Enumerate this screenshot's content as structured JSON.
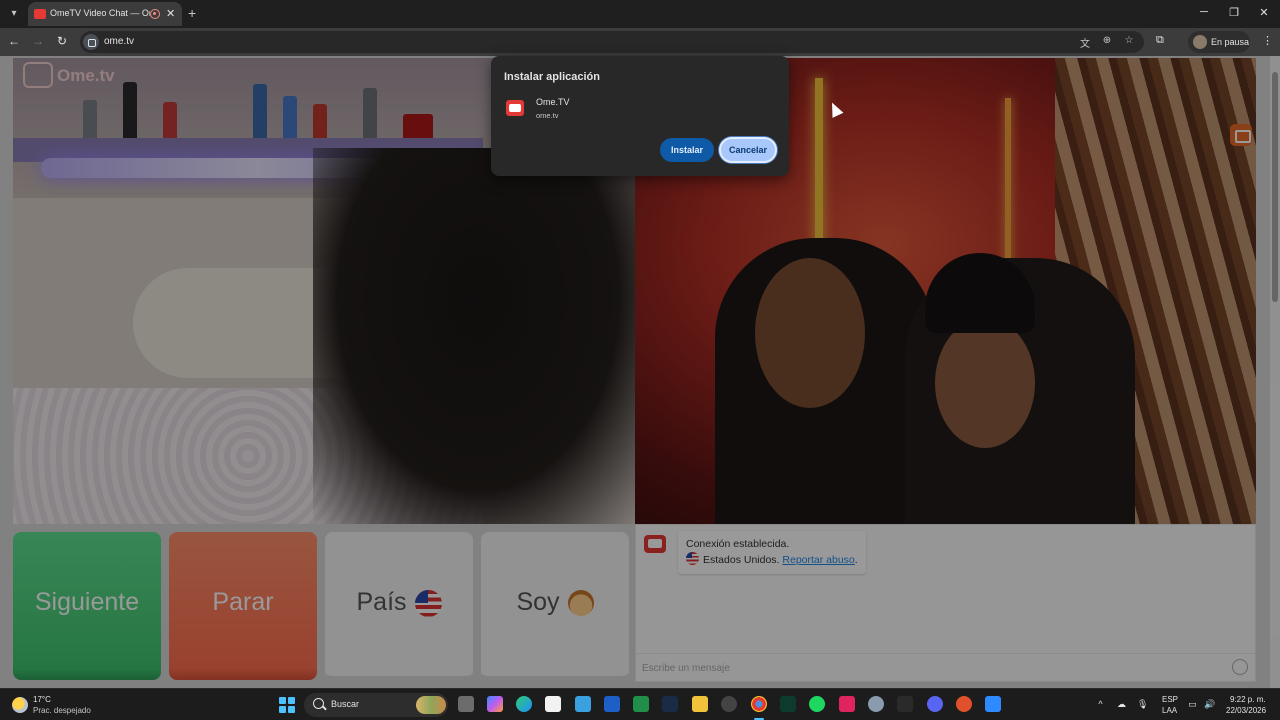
{
  "browser": {
    "tab_title": "OmeTV Video Chat — Ome",
    "new_tab_label": "+",
    "url": "ome.tv",
    "profile_label": "En pausa",
    "window_controls": [
      "minimize",
      "maximize",
      "close"
    ]
  },
  "page": {
    "logo_text": "Ome.tv",
    "controls": {
      "next_label": "Siguiente",
      "stop_label": "Parar",
      "country_label": "País",
      "gender_label": "Soy"
    },
    "chat": {
      "status_line": "Conexión establecida.",
      "country_line": "Estados Unidos.",
      "report_link": "Reportar abuso",
      "report_suffix": ".",
      "input_placeholder": "Escribe un mensaje"
    }
  },
  "dialog": {
    "title": "Instalar aplicación",
    "app_name": "Ome.TV",
    "app_origin": "ome.tv",
    "install_label": "Instalar",
    "cancel_label": "Cancelar"
  },
  "taskbar": {
    "weather_temp": "17°C",
    "weather_desc": "Prac. despejado",
    "search_label": "Buscar",
    "language": "ESP",
    "language_sub": "LAA",
    "time": "9:22 p. m.",
    "date": "22/03/2026"
  },
  "colors": {
    "accent_green": "#3fc46f",
    "accent_red": "#ff6e4f",
    "dialog_bg": "#282828",
    "install_button": "#0f5aa6",
    "cancel_button": "#a8c7fa",
    "brand_red": "#e53935"
  }
}
